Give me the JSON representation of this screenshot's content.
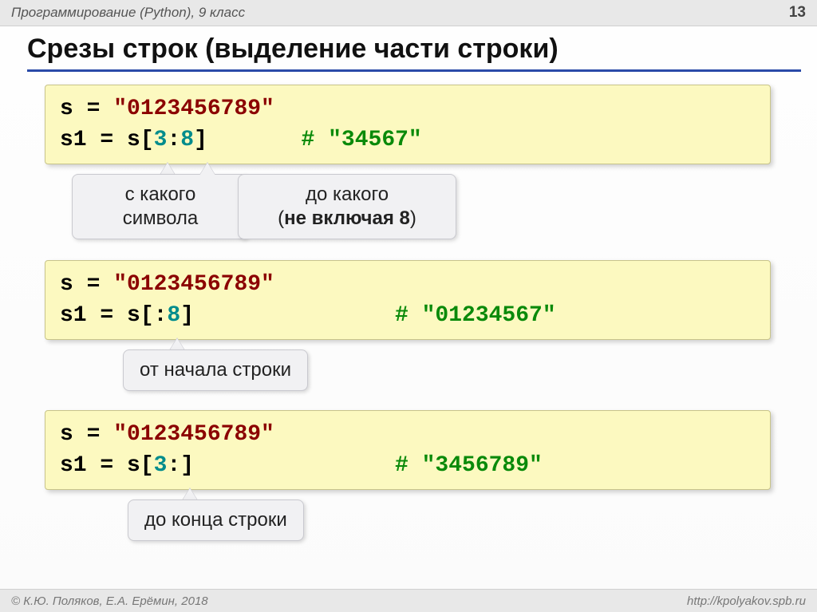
{
  "header": {
    "course": "Программирование (Python), 9 класс",
    "page": "13"
  },
  "title": "Срезы строк (выделение части строки)",
  "box1": {
    "l1_a": "s = ",
    "l1_str": "\"0123456789\"",
    "l2_a": "s1 = s[",
    "l2_i": "3",
    "l2_b": ":",
    "l2_j": "8",
    "l2_c": "]",
    "l2_pad": "       ",
    "l2_comment": "# \"34567\""
  },
  "call1a_l1": "с какого",
  "call1a_l2": "символа",
  "call1b_l1": "до какого",
  "call1b_l2a": "(",
  "call1b_l2b": "не включая 8",
  "call1b_l2c": ")",
  "box2": {
    "l1_a": "s = ",
    "l1_str": "\"0123456789\"",
    "l2_a": "s1 = s[:",
    "l2_j": "8",
    "l2_c": "]",
    "l2_comment": "# \"01234567\""
  },
  "call2": "от начала строки",
  "box3": {
    "l1_a": "s = ",
    "l1_str": "\"0123456789\"",
    "l2_a": "s1 = s[",
    "l2_i": "3",
    "l2_c": ":]",
    "l2_comment": "# \"3456789\""
  },
  "call3": "до конца строки",
  "footer": {
    "copyright": "© К.Ю. Поляков, Е.А. Ерёмин, 2018",
    "url": "http://kpolyakov.spb.ru"
  }
}
